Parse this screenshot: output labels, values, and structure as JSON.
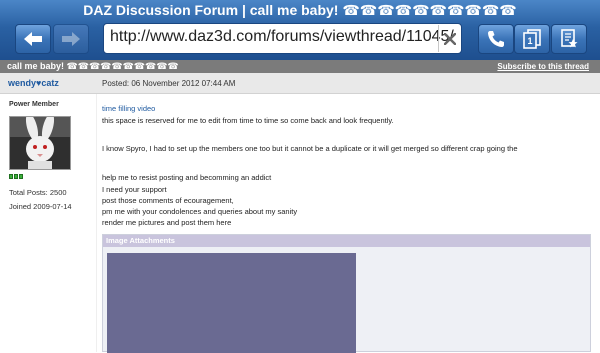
{
  "window": {
    "title": "DAZ Discussion Forum | call me baby! ☎☎☎☎☎☎☎☎☎☎"
  },
  "toolbar": {
    "back_icon": "back-arrow-icon",
    "forward_icon": "forward-arrow-icon",
    "url": "http://www.daz3d.com/forums/viewthread/11045/",
    "clear_icon": "close-icon",
    "phone_icon": "phone-icon",
    "tabs_icon": "tabs-icon",
    "tabs_count": "1",
    "bookmark_icon": "bookmark-icon"
  },
  "thread": {
    "title": "call me baby! ☎☎☎☎☎☎☎☎☎☎",
    "subscribe_label": "Subscribe to this thread"
  },
  "post": {
    "username": "wendy",
    "username_suffix": "catz",
    "posted": "Posted: 06 November 2012 07:44 AM",
    "user": {
      "rank": "Power Member",
      "reputation_pips": 3,
      "total_posts": "Total Posts:  2500",
      "joined": "Joined  2009-07-14"
    },
    "lines": {
      "link": "time filling video",
      "l1": "this space is reserved for me to edit from time to time so come back and look frequently.",
      "l2": "I know Spyro, I had to set up the members one too but it cannot be a duplicate or it will get merged so different crap going the",
      "l3": "help me to resist posting and becomming an addict",
      "l4": "I need your support",
      "l5": "post those comments of ecouragement,",
      "l6": "pm me with your condolences and queries about my sanity",
      "l7": "render me pictures and post them here"
    },
    "attachments_header": "Image Attachments"
  },
  "colors": {
    "chrome_blue": "#2a61a3",
    "link_blue": "#1f5aa0",
    "thread_bar": "#7b7b7b",
    "attach_header": "#c9c4dd",
    "attach_image": "#6a6a92"
  }
}
